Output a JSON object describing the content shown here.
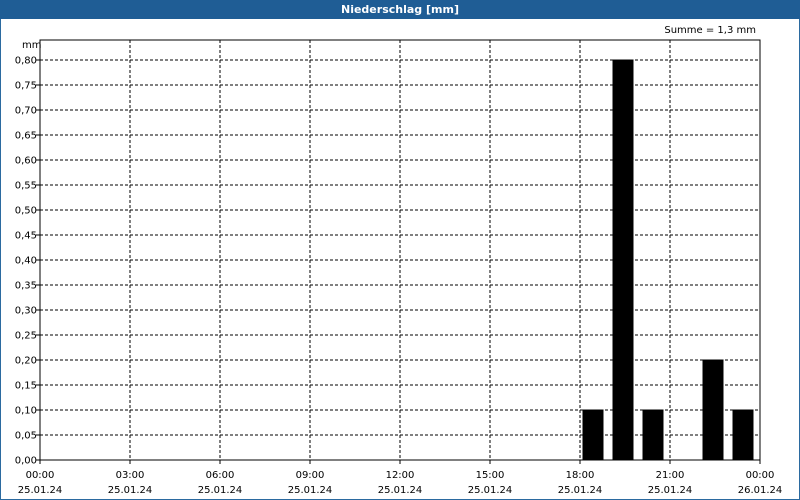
{
  "window": {
    "title": "Niederschlag [mm]"
  },
  "summary": "Summe = 1,3 mm",
  "chart_data": {
    "type": "bar",
    "title": "Niederschlag [mm]",
    "ylabel": "mm",
    "ylim": [
      0,
      0.85
    ],
    "yticks": [
      0.0,
      0.05,
      0.1,
      0.15,
      0.2,
      0.25,
      0.3,
      0.35,
      0.4,
      0.45,
      0.5,
      0.55,
      0.6,
      0.65,
      0.7,
      0.75,
      0.8
    ],
    "ytick_labels": [
      "0,00",
      "0,05",
      "0,10",
      "0,15",
      "0,20",
      "0,25",
      "0,30",
      "0,35",
      "0,40",
      "0,45",
      "0,50",
      "0,55",
      "0,60",
      "0,65",
      "0,70",
      "0,75",
      "0,80"
    ],
    "xlim_hours": [
      0,
      24
    ],
    "xticks_hours": [
      0,
      3,
      6,
      9,
      12,
      15,
      18,
      21,
      24
    ],
    "xtick_labels": [
      [
        "00:00",
        "25.01.24"
      ],
      [
        "03:00",
        "25.01.24"
      ],
      [
        "06:00",
        "25.01.24"
      ],
      [
        "09:00",
        "25.01.24"
      ],
      [
        "12:00",
        "25.01.24"
      ],
      [
        "15:00",
        "25.01.24"
      ],
      [
        "18:00",
        "25.01.24"
      ],
      [
        "21:00",
        "25.01.24"
      ],
      [
        "00:00",
        "26.01.24"
      ]
    ],
    "bars": [
      {
        "start_hour": 18,
        "end_hour": 19,
        "value": 0.1
      },
      {
        "start_hour": 19,
        "end_hour": 20,
        "value": 0.8
      },
      {
        "start_hour": 20,
        "end_hour": 21,
        "value": 0.1
      },
      {
        "start_hour": 22,
        "end_hour": 23,
        "value": 0.2
      },
      {
        "start_hour": 23,
        "end_hour": 24,
        "value": 0.1
      }
    ],
    "grid": true,
    "colors": {
      "bar": "#000000",
      "titlebar": "#1f5d95"
    }
  }
}
